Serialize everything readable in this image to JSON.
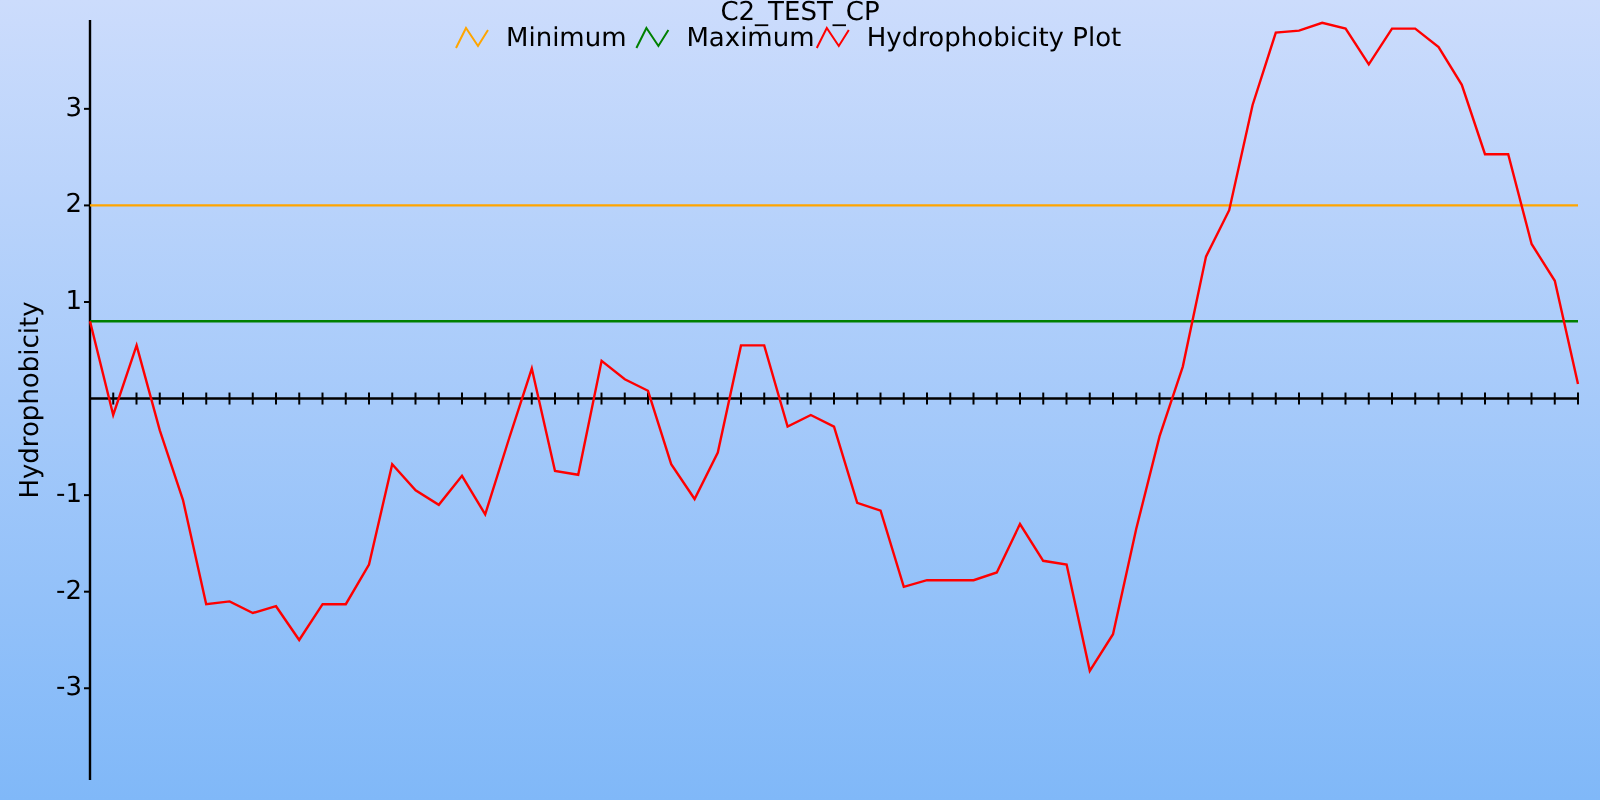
{
  "chart_data": {
    "type": "line",
    "title": "C2_TEST_CP",
    "ylabel": "Hydrophobicity",
    "categories": [
      null,
      null,
      null,
      null,
      null,
      null,
      null,
      null,
      null,
      null,
      null,
      null,
      null,
      null,
      null,
      null,
      null,
      null,
      null,
      null,
      null,
      null,
      null,
      null,
      null,
      null,
      null,
      null,
      null,
      null,
      null,
      null,
      null,
      null,
      null,
      null,
      null,
      null,
      null,
      null,
      null,
      null,
      null,
      null,
      null,
      null,
      null,
      null,
      null,
      null,
      null,
      null,
      null,
      null,
      null,
      null,
      null,
      null,
      null,
      null,
      null,
      null,
      null,
      null,
      null
    ],
    "ylim": [
      -3.95,
      3.92
    ],
    "legend": "top",
    "yticks": [
      {
        "value": -3,
        "label": "-3"
      },
      {
        "value": -2,
        "label": "-2"
      },
      {
        "value": -1,
        "label": "-1"
      },
      {
        "value": 1,
        "label": "1"
      },
      {
        "value": 2,
        "label": "2"
      },
      {
        "value": 3,
        "label": "3"
      }
    ],
    "series": [
      {
        "name": "Minimum",
        "color": "#ffa500",
        "values": [
          2,
          2,
          2,
          2,
          2,
          2,
          2,
          2,
          2,
          2,
          2,
          2,
          2,
          2,
          2,
          2,
          2,
          2,
          2,
          2,
          2,
          2,
          2,
          2,
          2,
          2,
          2,
          2,
          2,
          2,
          2,
          2,
          2,
          2,
          2,
          2,
          2,
          2,
          2,
          2,
          2,
          2,
          2,
          2,
          2,
          2,
          2,
          2,
          2,
          2,
          2,
          2,
          2,
          2,
          2,
          2,
          2,
          2,
          2,
          2,
          2,
          2,
          2,
          2,
          2
        ]
      },
      {
        "name": "Maximum",
        "color": "#008000",
        "values": [
          0.8,
          0.8,
          0.8,
          0.8,
          0.8,
          0.8,
          0.8,
          0.8,
          0.8,
          0.8,
          0.8,
          0.8,
          0.8,
          0.8,
          0.8,
          0.8,
          0.8,
          0.8,
          0.8,
          0.8,
          0.8,
          0.8,
          0.8,
          0.8,
          0.8,
          0.8,
          0.8,
          0.8,
          0.8,
          0.8,
          0.8,
          0.8,
          0.8,
          0.8,
          0.8,
          0.8,
          0.8,
          0.8,
          0.8,
          0.8,
          0.8,
          0.8,
          0.8,
          0.8,
          0.8,
          0.8,
          0.8,
          0.8,
          0.8,
          0.8,
          0.8,
          0.8,
          0.8,
          0.8,
          0.8,
          0.8,
          0.8,
          0.8,
          0.8,
          0.8,
          0.8,
          0.8,
          0.8,
          0.8,
          0.8
        ]
      },
      {
        "name": "Hydrophobicity Plot",
        "color": "#ff0000",
        "values": [
          0.8,
          -0.17,
          0.55,
          -0.33,
          -1.05,
          -2.13,
          -2.1,
          -2.22,
          -2.15,
          -2.5,
          -2.13,
          -2.13,
          -1.72,
          -0.68,
          -0.95,
          -1.1,
          -0.8,
          -1.2,
          -0.43,
          0.31,
          -0.75,
          -0.79,
          0.39,
          0.2,
          0.08,
          -0.68,
          -1.04,
          -0.56,
          0.55,
          0.55,
          -0.29,
          -0.17,
          -0.29,
          -1.08,
          -1.16,
          -1.95,
          -1.88,
          -1.88,
          -1.88,
          -1.8,
          -1.3,
          -1.68,
          -1.72,
          -2.82,
          -2.44,
          -1.35,
          -0.39,
          0.33,
          1.47,
          1.95,
          3.04,
          3.79,
          3.81,
          3.89,
          3.83,
          3.46,
          3.83,
          3.83,
          3.64,
          3.25,
          2.53,
          2.53,
          1.6,
          1.22,
          0.15
        ]
      }
    ]
  }
}
